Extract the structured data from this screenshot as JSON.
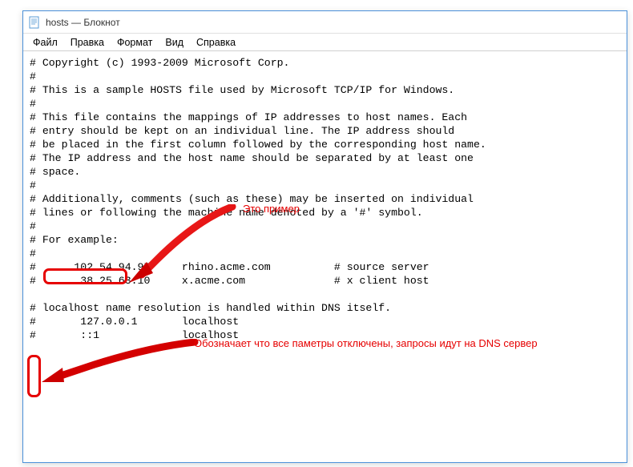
{
  "window": {
    "title": "hosts — Блокнот"
  },
  "menu": {
    "file": "Файл",
    "edit": "Правка",
    "format": "Формат",
    "view": "Вид",
    "help": "Справка"
  },
  "lines": {
    "l0": "# Copyright (c) 1993-2009 Microsoft Corp.",
    "l1": "#",
    "l2": "# This is a sample HOSTS file used by Microsoft TCP/IP for Windows.",
    "l3": "#",
    "l4": "# This file contains the mappings of IP addresses to host names. Each",
    "l5": "# entry should be kept on an individual line. The IP address should",
    "l6": "# be placed in the first column followed by the corresponding host name.",
    "l7": "# The IP address and the host name should be separated by at least one",
    "l8": "# space.",
    "l9": "#",
    "l10": "# Additionally, comments (such as these) may be inserted on individual",
    "l11": "# lines or following the machine name denoted by a '#' symbol.",
    "l12": "#",
    "l13": "# For example:",
    "l14": "#",
    "l15": "#      102.54.94.97     rhino.acme.com          # source server",
    "l16": "#       38.25.63.10     x.acme.com              # x client host",
    "l17": "",
    "l18": "# localhost name resolution is handled within DNS itself.",
    "l19": "#       127.0.0.1       localhost",
    "l20": "#       ::1             localhost"
  },
  "annotations": {
    "label1": "Это пример",
    "label2": "Обозначает что все паметры отключены, запросы идут на DNS сервер"
  }
}
